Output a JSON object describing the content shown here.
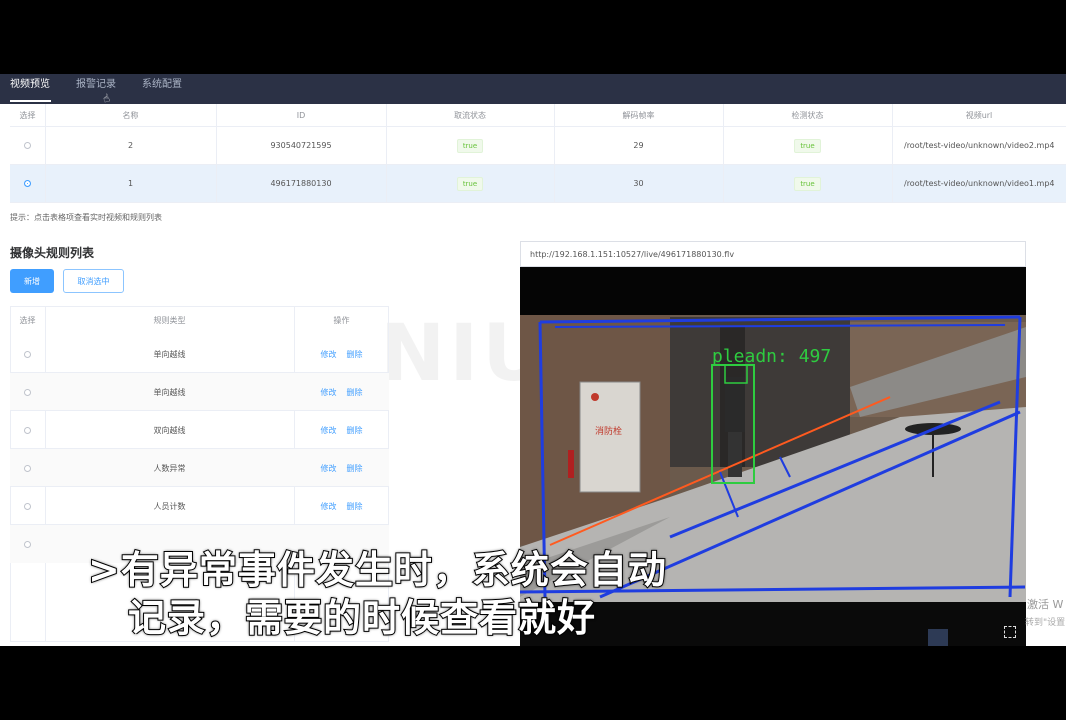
{
  "nav": {
    "tabs": [
      {
        "label": "视频预览",
        "active": true
      },
      {
        "label": "报警记录",
        "active": false
      },
      {
        "label": "系统配置",
        "active": false
      }
    ]
  },
  "camera_table": {
    "headers": [
      "选择",
      "名称",
      "ID",
      "取流状态",
      "解码帧率",
      "检测状态",
      "视频url"
    ],
    "rows": [
      {
        "selected": false,
        "name": "2",
        "id": "930540721595",
        "stream_status": "true",
        "fps": "29",
        "detect_status": "true",
        "url": "/root/test-video/unknown/video2.mp4"
      },
      {
        "selected": true,
        "name": "1",
        "id": "496171880130",
        "stream_status": "true",
        "fps": "30",
        "detect_status": "true",
        "url": "/root/test-video/unknown/video1.mp4"
      }
    ]
  },
  "hint": "提示：点击表格项查看实时视频和规则列表",
  "rules": {
    "title": "摄像头规则列表",
    "add_label": "新增",
    "deselect_label": "取消选中",
    "headers": [
      "选择",
      "规则类型",
      "操作"
    ],
    "edit_label": "修改",
    "delete_label": "删除",
    "rows": [
      {
        "type": "单向越线"
      },
      {
        "type": "单向越线"
      },
      {
        "type": "双向越线"
      },
      {
        "type": "人数异常"
      },
      {
        "type": "人员计数"
      },
      {
        "type": ""
      }
    ]
  },
  "video": {
    "url": "http://192.168.1.151:10527/live/496171880130.flv",
    "overlay_label": "pleadn: 497",
    "sign_text": "消防栓"
  },
  "watermark": "NIU",
  "windows_activation": {
    "line1": "激活 W",
    "line2": "转到\"设置"
  },
  "subtitle": {
    "line1": ">有异常事件发生时，系统会自动",
    "line2": "记录，需要的时候查看就好"
  },
  "colors": {
    "accent": "#409eff",
    "nav_bg": "#2b3145",
    "tag_green": "#67c23a"
  }
}
